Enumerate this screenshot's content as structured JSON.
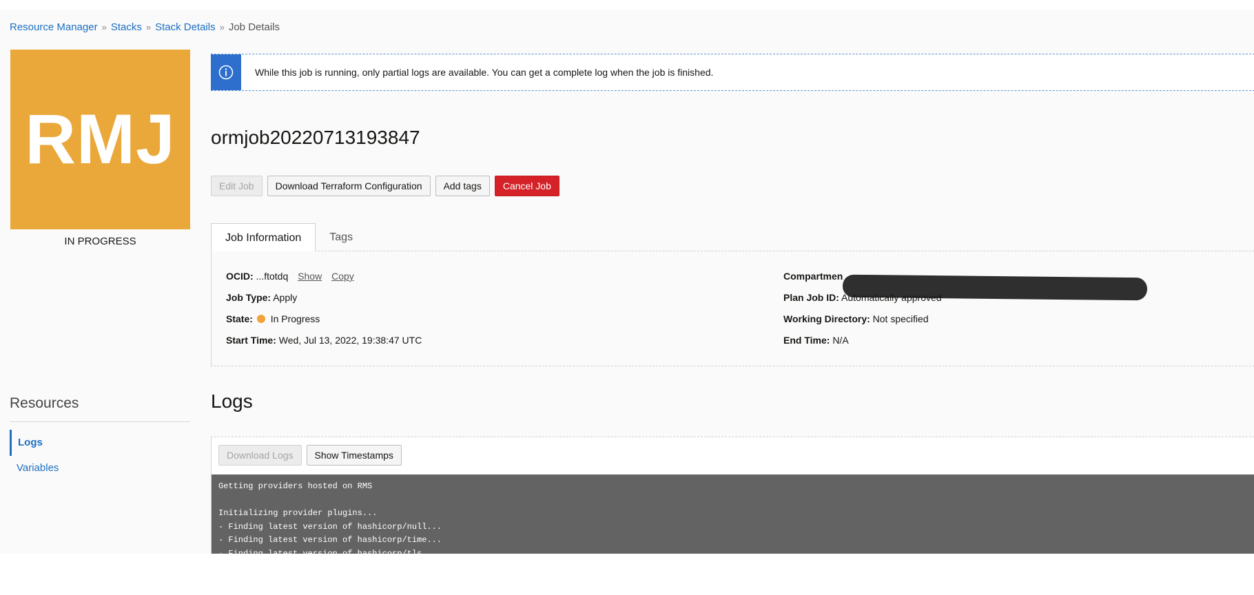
{
  "breadcrumb": {
    "items": [
      "Resource Manager",
      "Stacks",
      "Stack Details"
    ],
    "current": "Job Details",
    "separator": "»"
  },
  "tile": {
    "initials": "RMJ",
    "color": "#eba83a"
  },
  "job_status": "IN PROGRESS",
  "banner": {
    "icon": "info-icon",
    "text": "While this job is running, only partial logs are available. You can get a complete log when the job is finished."
  },
  "job_title": "ormjob20220713193847",
  "actions": {
    "edit": "Edit Job",
    "download_config": "Download Terraform Configuration",
    "add_tags": "Add tags",
    "cancel": "Cancel Job"
  },
  "tabs": {
    "job_information": "Job Information",
    "tags": "Tags"
  },
  "job_info": {
    "ocid_label": "OCID:",
    "ocid_value": "...ftotdq",
    "ocid_show": "Show",
    "ocid_copy": "Copy",
    "job_type_label": "Job Type:",
    "job_type_value": "Apply",
    "state_label": "State:",
    "state_value": "In Progress",
    "state_color": "#f1a239",
    "start_time_label": "Start Time:",
    "start_time_value": "Wed, Jul 13, 2022, 19:38:47 UTC",
    "compartment_label": "Compartmen",
    "plan_job_label": "Plan Job ID:",
    "plan_job_value": "Automatically approved",
    "working_dir_label": "Working Directory:",
    "working_dir_value": "Not specified",
    "end_time_label": "End Time:",
    "end_time_value": "N/A"
  },
  "resources": {
    "heading": "Resources",
    "items": [
      "Logs",
      "Variables"
    ]
  },
  "logs": {
    "heading": "Logs",
    "download": "Download Logs",
    "show_timestamps": "Show Timestamps",
    "lines": [
      "Getting providers hosted on RMS",
      "",
      "Initializing provider plugins...",
      "- Finding latest version of hashicorp/null...",
      "- Finding latest version of hashicorp/time...",
      "- Finding latest version of hashicorp/tls..."
    ]
  }
}
